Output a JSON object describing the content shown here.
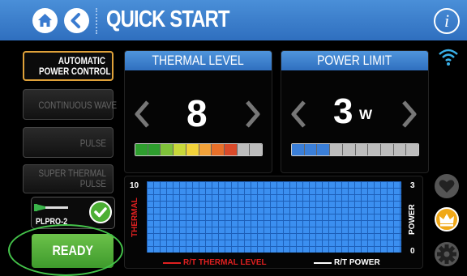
{
  "header": {
    "title": "QUICK START",
    "info_label": "i",
    "icons": [
      "home-icon",
      "back-icon",
      "info-icon"
    ]
  },
  "modes": [
    {
      "label": "AUTOMATIC\nPOWER CONTROL",
      "active": true
    },
    {
      "label": "CONTINUOUS WAVE",
      "active": false
    },
    {
      "label": "PULSE",
      "active": false
    },
    {
      "label": "SUPER THERMAL\nPULSE",
      "active": false
    }
  ],
  "thermal": {
    "title": "THERMAL LEVEL",
    "value": "8",
    "level": 8,
    "max": 10
  },
  "power": {
    "title": "POWER LIMIT",
    "value": "3",
    "unit": "W",
    "level": 3,
    "max": 10
  },
  "chart": {
    "y_left_max": "10",
    "y_right_max": "3",
    "y_right_min": "0",
    "left_axis_label": "THERMAL",
    "right_axis_label": "POWER",
    "legend": [
      {
        "label": "R/T THERMAL LEVEL",
        "color": "#e02020"
      },
      {
        "label": "R/T POWER",
        "color": "#ffffff"
      }
    ]
  },
  "probe": {
    "label": "PLPRO-2",
    "connected": true
  },
  "ready_button": {
    "label": "READY"
  },
  "right_icons": [
    "wifi-icon",
    "heart-icon",
    "crown-icon",
    "gear-icon"
  ],
  "colors": {
    "accent_blue": "#2f6fbf",
    "active_border": "#e0a23a",
    "ready_green": "#4caf34",
    "thermal_gradient": [
      "#2e9e2e",
      "#7fc23a",
      "#c8d83a",
      "#f2d23a",
      "#f2a23a",
      "#e8702a",
      "#d94a2a"
    ],
    "power_fill": "#3b7fd8"
  }
}
